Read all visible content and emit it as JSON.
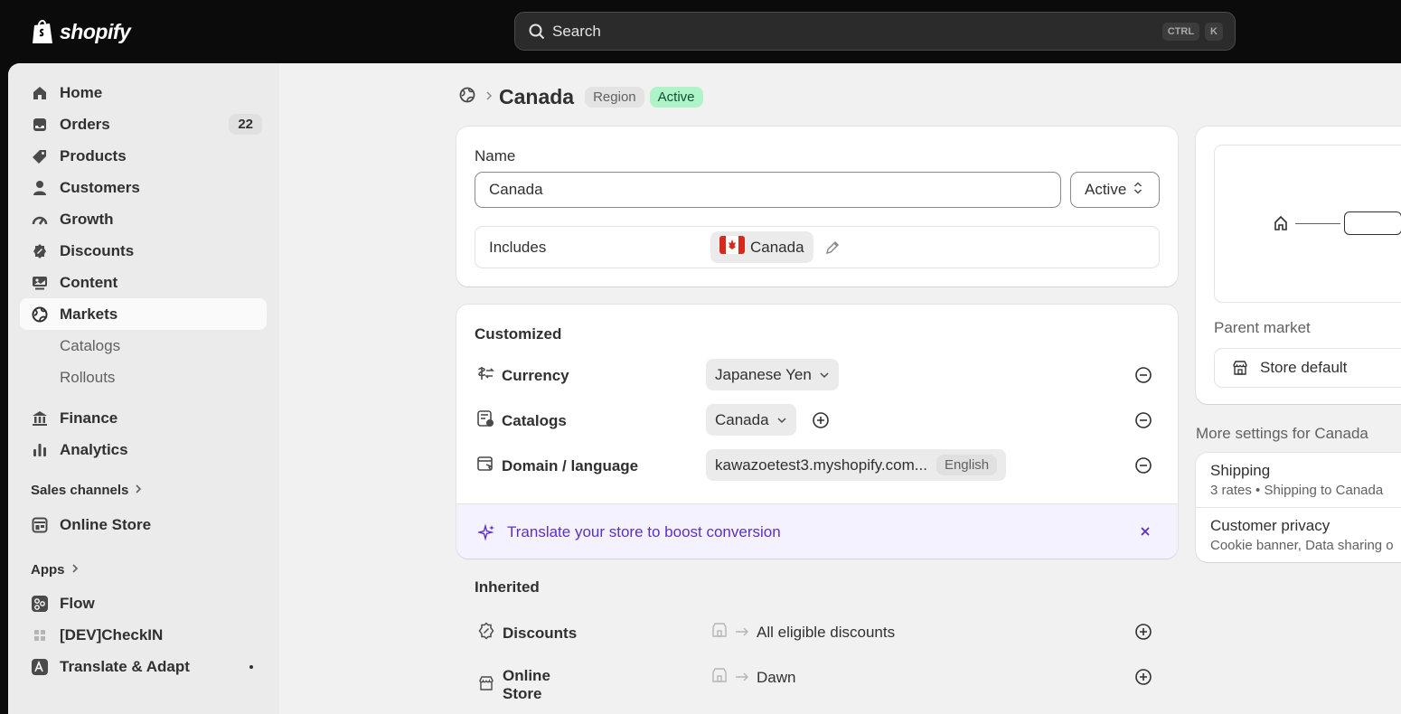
{
  "topbar": {
    "logo_text": "shopify",
    "search_placeholder": "Search",
    "shortcut_keys": [
      "CTRL",
      "K"
    ]
  },
  "sidebar": {
    "items": [
      {
        "label": "Home",
        "icon": "home-icon"
      },
      {
        "label": "Orders",
        "icon": "inbox-icon",
        "badge": "22"
      },
      {
        "label": "Products",
        "icon": "tag-icon"
      },
      {
        "label": "Customers",
        "icon": "person-icon"
      },
      {
        "label": "Growth",
        "icon": "gauge-icon"
      },
      {
        "label": "Discounts",
        "icon": "discount-icon"
      },
      {
        "label": "Content",
        "icon": "content-icon"
      },
      {
        "label": "Markets",
        "icon": "globe-icon",
        "active": true
      }
    ],
    "markets_sub": [
      "Catalogs",
      "Rollouts"
    ],
    "items2": [
      {
        "label": "Finance",
        "icon": "bank-icon"
      },
      {
        "label": "Analytics",
        "icon": "bar-chart-icon"
      }
    ],
    "sales_channels_label": "Sales channels",
    "online_store_label": "Online Store",
    "apps_label": "Apps",
    "apps": [
      {
        "label": "Flow",
        "icon": "flow-icon"
      },
      {
        "label": "[DEV]CheckIN",
        "icon": "app-grid-icon"
      },
      {
        "label": "Translate & Adapt",
        "icon": "translate-icon"
      }
    ]
  },
  "header": {
    "title": "Canada",
    "region_tag": "Region",
    "status_tag": "Active"
  },
  "name_card": {
    "name_label": "Name",
    "name_value": "Canada",
    "status_select": "Active",
    "includes_label": "Includes",
    "includes_value": "Canada"
  },
  "customized": {
    "heading": "Customized",
    "rows": [
      {
        "label": "Currency",
        "value": "Japanese Yen"
      },
      {
        "label": "Catalogs",
        "value": "Canada"
      },
      {
        "label": "Domain / language",
        "value": "kawazoetest3.myshopify.com...",
        "tag": "English"
      }
    ],
    "banner_text": "Translate your store to boost conversion"
  },
  "inherited": {
    "heading": "Inherited",
    "rows": [
      {
        "label": "Discounts",
        "value": "All eligible discounts"
      },
      {
        "label": "Online Store",
        "value": "Dawn"
      }
    ]
  },
  "right_panel": {
    "parent_market_label": "Parent market",
    "parent_market_value": "Store default",
    "more_settings_heading": "More settings for Canada",
    "settings": [
      {
        "title": "Shipping",
        "subtitle": "3 rates • Shipping to Canada"
      },
      {
        "title": "Customer privacy",
        "subtitle": "Cookie banner, Data sharing o"
      }
    ]
  },
  "colors": {
    "topbar": "#0b0b0b",
    "background": "#f1f1f1",
    "active_tag_bg": "#aff3c8",
    "banner_bg": "#f5f2ff",
    "banner_text": "#5c2fc7"
  }
}
